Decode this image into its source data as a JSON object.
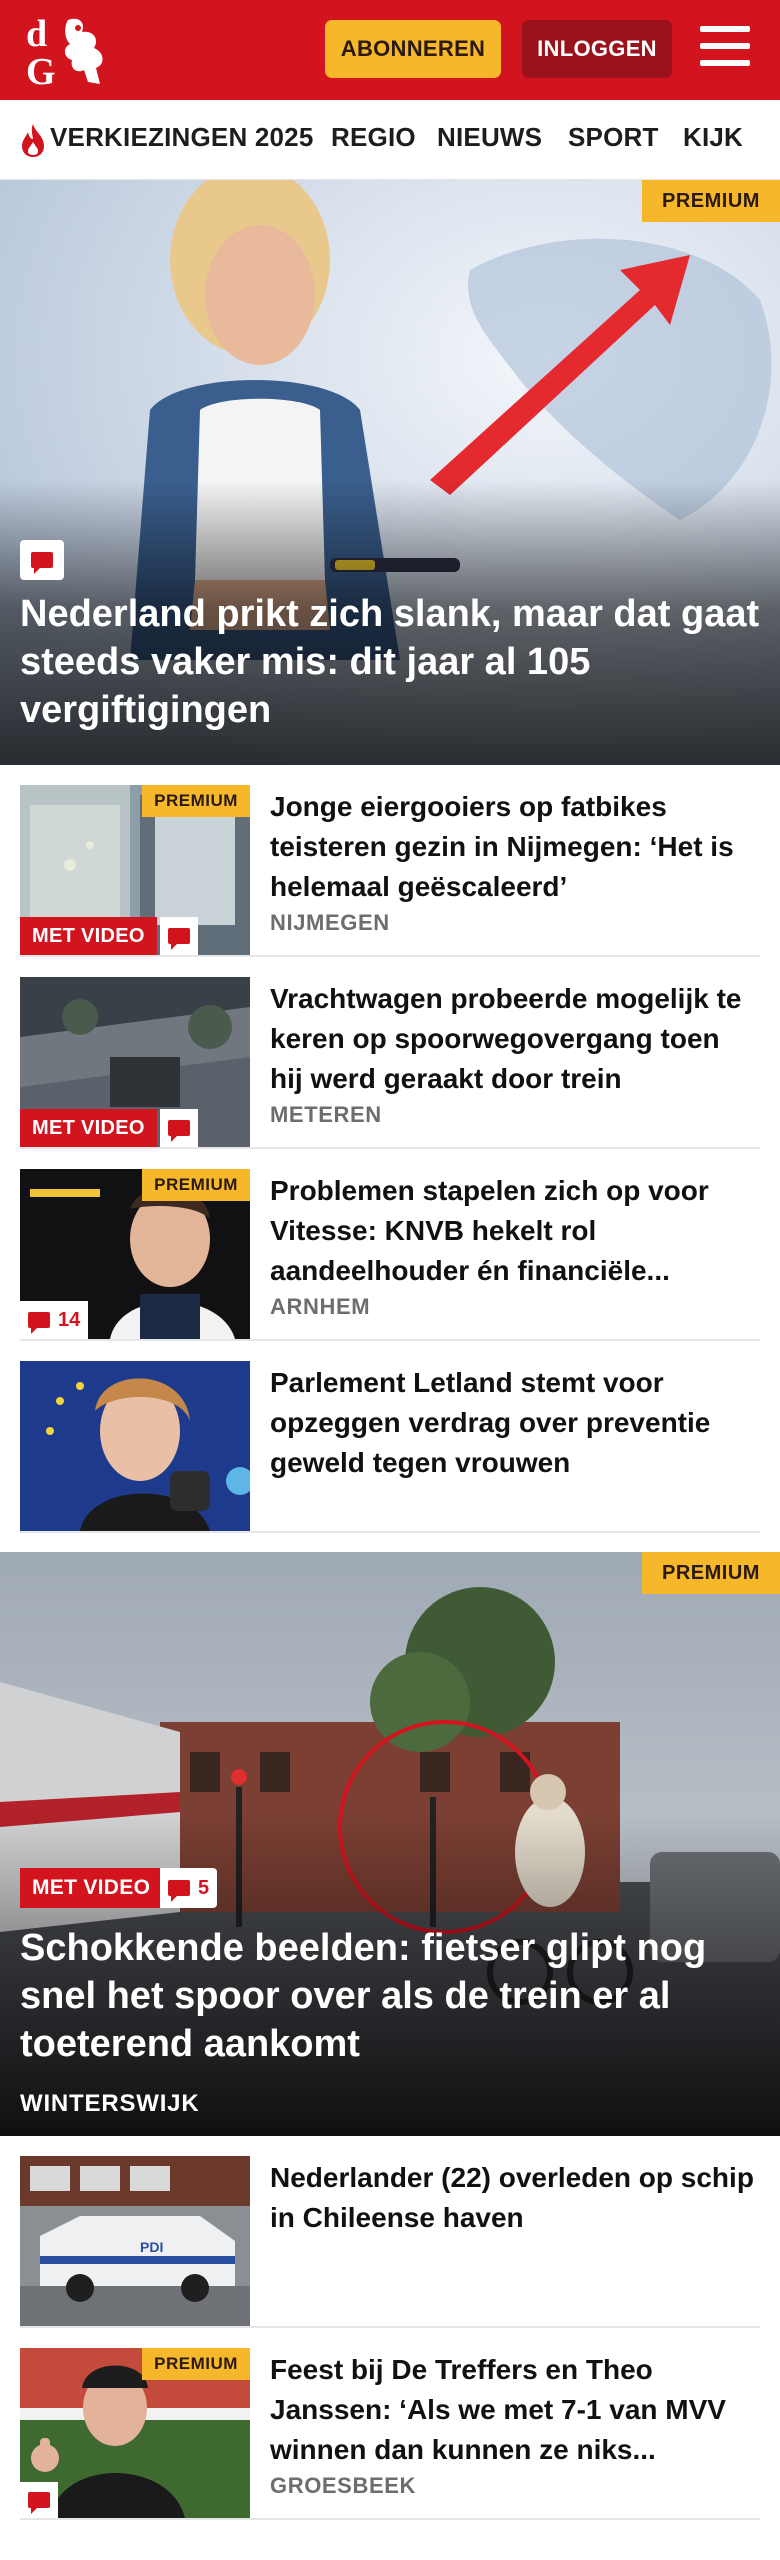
{
  "header": {
    "subscribe_label": "ABONNEREN",
    "login_label": "INLOGGEN",
    "brand_color": "#d2141e",
    "subscribe_color": "#f6b72a"
  },
  "nav": {
    "items": [
      "VERKIEZINGEN 2025",
      "REGIO",
      "NIEUWS",
      "SPORT",
      "KIJK"
    ]
  },
  "hero": {
    "badge": "PREMIUM",
    "title": "Nederland prikt zich slank, maar dat gaat steeds vaker mis: dit jaar al 105 vergiftigingen"
  },
  "articles": [
    {
      "title": "Jonge eiergooiers op fatbikes teisteren gezin in Nijmegen: ‘Het is helemaal geëscaleerd’",
      "location": "NIJMEGEN",
      "badge": "PREMIUM",
      "video": "MET VIDEO"
    },
    {
      "title": "Vrachtwagen probeerde mogelijk te keren op spoorwegovergang toen hij werd geraakt door trein",
      "location": "METEREN",
      "video": "MET VIDEO"
    },
    {
      "title": "Problemen stapelen zich op voor Vitesse: KNVB hekelt rol aandeelhouder én financiële...",
      "location": "ARNHEM",
      "badge": "PREMIUM",
      "comments": "14"
    },
    {
      "title": "Parlement Letland stemt voor opzeggen verdrag over preventie geweld tegen vrouwen"
    }
  ],
  "video_hero": {
    "badge": "PREMIUM",
    "video": "MET VIDEO",
    "comments": "5",
    "title": "Schokkende beelden: fietser glipt nog snel het spoor over als de trein er al toeterend aankomt",
    "location": "WINTERSWIJK"
  },
  "articles2": [
    {
      "title": "Nederlander (22) overleden op schip in Chileense haven"
    },
    {
      "title": "Feest bij De Treffers en Theo Janssen: ‘Als we met 7-1 van MVV winnen dan kunnen ze niks...",
      "location": "GROESBEEK",
      "badge": "PREMIUM"
    }
  ]
}
